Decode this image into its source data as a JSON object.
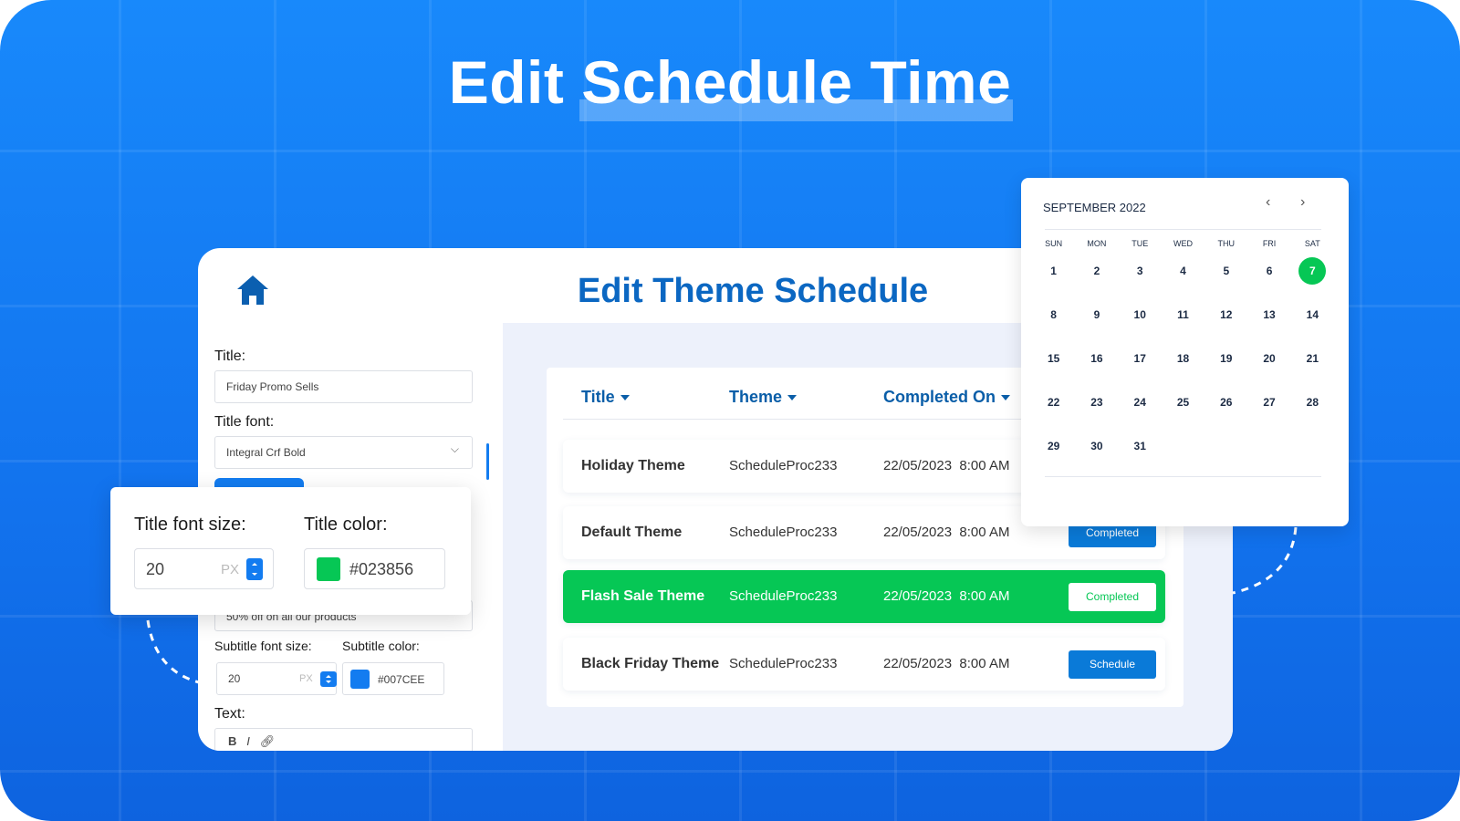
{
  "hero_title": {
    "part1": "Edit",
    "part2": "Schedule Time"
  },
  "card": {
    "title": "Edit Theme Schedule"
  },
  "form": {
    "title_label": "Title:",
    "title_value": "Friday Promo Sells",
    "font_label": "Title font:",
    "font_value": "Integral Crf Bold",
    "subtitle_value": "50% off on all our products",
    "subtitle_size_label": "Subtitle font size:",
    "subtitle_size_value": "20",
    "unit": "PX",
    "subtitle_color_label": "Subtitle color:",
    "subtitle_color_value": "#007CEE",
    "text_label": "Text:",
    "toolbar": {
      "bold": "B",
      "italic": "I"
    }
  },
  "popup": {
    "size_label": "Title font size:",
    "size_value": "20",
    "unit": "PX",
    "color_label": "Title color:",
    "color_value": "#023856",
    "swatch_color": "#06c755"
  },
  "table": {
    "headers": [
      "Title",
      "Theme",
      "Completed On"
    ],
    "rows": [
      {
        "title": "Holiday Theme",
        "theme": "ScheduleProc233",
        "date": "22/05/2023",
        "time": "8:00 AM",
        "status": ""
      },
      {
        "title": "Default Theme",
        "theme": "ScheduleProc233",
        "date": "22/05/2023",
        "time": "8:00 AM",
        "status": "Completed"
      },
      {
        "title": "Flash Sale Theme",
        "theme": "ScheduleProc233",
        "date": "22/05/2023",
        "time": "8:00 AM",
        "status": "Completed",
        "highlighted": true
      },
      {
        "title": "Black Friday Theme",
        "theme": "ScheduleProc233",
        "date": "22/05/2023",
        "time": "8:00 AM",
        "status": "Schedule"
      }
    ]
  },
  "calendar": {
    "month": "SEPTEMBER 2022",
    "prev": "‹",
    "next": "›",
    "weekdays": [
      "SUN",
      "MON",
      "TUE",
      "WED",
      "THU",
      "FRI",
      "SAT"
    ],
    "selected_day": 7,
    "days": 31,
    "start_offset": 0
  },
  "colors": {
    "accent": "#0b67c2",
    "green": "#06c755",
    "blue": "#137cf0"
  }
}
